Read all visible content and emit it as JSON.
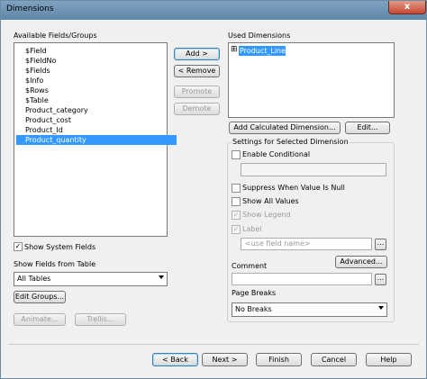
{
  "window": {
    "title": "Dimensions",
    "close": "x"
  },
  "available": {
    "label": "Available Fields/Groups",
    "items": [
      "$Field",
      "$FieldNo",
      "$Fields",
      "$Info",
      "$Rows",
      "$Table",
      "Product_category",
      "Product_cost",
      "Product_Id",
      "Product_quantity"
    ],
    "selected_index": 9
  },
  "middle_buttons": {
    "add": "Add >",
    "remove": "< Remove",
    "promote": "Promote",
    "demote": "Demote"
  },
  "used": {
    "label": "Used Dimensions",
    "expander": "⊞",
    "items": [
      "Product_Line"
    ]
  },
  "used_buttons": {
    "add_calc": "Add Calculated Dimension...",
    "edit": "Edit..."
  },
  "settings": {
    "label": "Settings for Selected Dimension",
    "enable_conditional": "Enable Conditional",
    "suppress_null": "Suppress When Value Is Null",
    "show_all_values": "Show All Values",
    "show_legend": "Show Legend",
    "label_check": "Label",
    "label_placeholder": "<use field name>",
    "ellipsis": "...",
    "advanced": "Advanced...",
    "comment": "Comment",
    "page_breaks": "Page Breaks",
    "page_breaks_value": "No Breaks",
    "checkmark": "✓"
  },
  "left_bottom": {
    "show_system_fields": "Show System Fields",
    "show_fields_from_table": "Show Fields from Table",
    "table_value": "All Tables",
    "edit_groups": "Edit Groups...",
    "animate": "Animate...",
    "trellis": "Trellis..."
  },
  "footer": {
    "back": "< Back",
    "next": "Next >",
    "finish": "Finish",
    "cancel": "Cancel",
    "help": "Help"
  }
}
